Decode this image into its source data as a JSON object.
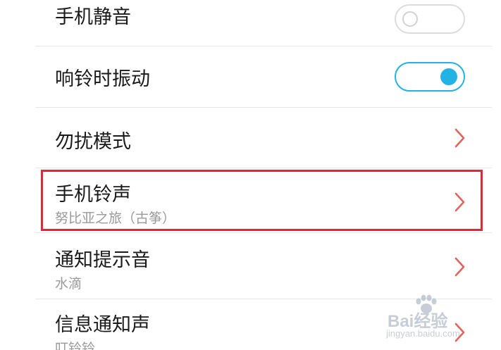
{
  "settings": {
    "items": [
      {
        "label": "手机静音",
        "control": "toggle",
        "enabled": false
      },
      {
        "label": "响铃时振动",
        "control": "toggle",
        "enabled": true
      },
      {
        "label": "勿扰模式",
        "control": "chevron-right-icon"
      },
      {
        "label": "手机铃声",
        "value": "努比亚之旅（古筝）",
        "control": "chevron-right-icon"
      },
      {
        "label": "通知提示音",
        "value": "水滴",
        "control": "chevron-right-icon"
      },
      {
        "label": "信息通知声",
        "value": "叮铃铃",
        "control": "chevron-right-icon"
      }
    ]
  },
  "colors": {
    "accent": "#22b2e3",
    "chevron": "#e0645c",
    "highlight_border": "#d62d3a",
    "divider": "#e6e6e6"
  },
  "watermark": {
    "text": "Bai经验",
    "url": "jingyan.baidu.com"
  }
}
